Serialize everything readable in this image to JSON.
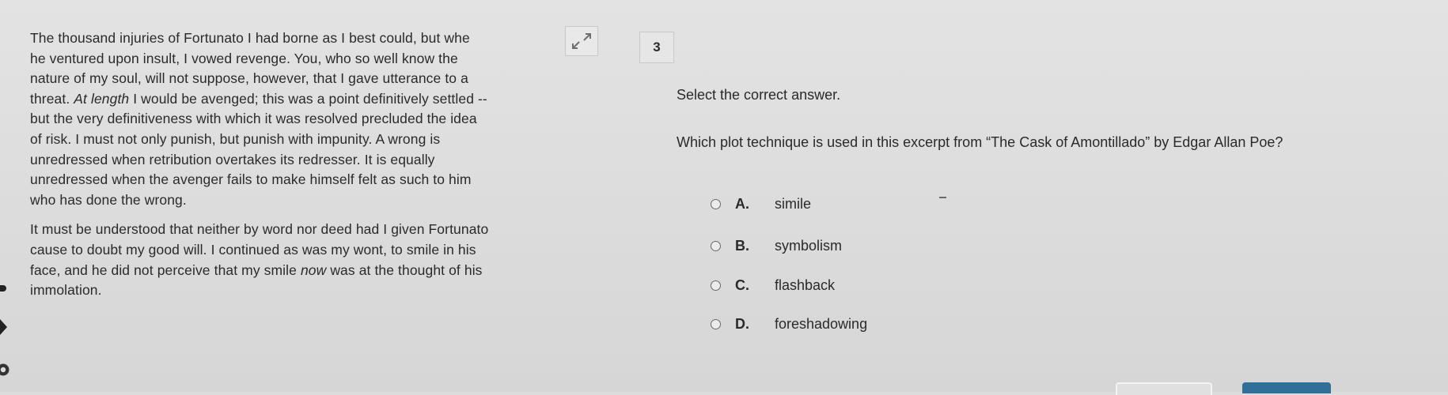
{
  "passage": {
    "paragraph1_before_italic": "The thousand injuries of Fortunato I had borne as I best could, but whe\nhe ventured upon insult, I vowed revenge. You, who so well know the\nnature of my soul, will not suppose, however, that I gave utterance to a\nthreat. ",
    "paragraph1_italic": "At length",
    "paragraph1_after_italic": " I would be avenged; this was a point definitively settled --\nbut the very definitiveness with which it was resolved precluded the idea\nof risk. I must not only punish, but punish with impunity. A wrong is\nunredressed when retribution overtakes its redresser. It is equally\nunredressed when the avenger fails to make himself felt as such to him\nwho has done the wrong.",
    "paragraph2_before_italic": "It must be understood that neither by word nor deed had I given Fortunato\ncause to doubt my good will. I continued as was my wont, to smile in his\nface, and he did not perceive that my smile ",
    "paragraph2_italic": "now",
    "paragraph2_after_italic": " was at the thought of his\nimmolation."
  },
  "question": {
    "number": "3",
    "prompt": "Select the correct answer.",
    "text": "Which plot technique is used in this excerpt from “The Cask of Amontillado” by Edgar Allan Poe?",
    "options": [
      {
        "letter": "A.",
        "text": "simile"
      },
      {
        "letter": "B.",
        "text": "symbolism"
      },
      {
        "letter": "C.",
        "text": "flashback"
      },
      {
        "letter": "D.",
        "text": "foreshadowing"
      }
    ]
  },
  "icons": {
    "expand": "expand-arrows-icon",
    "gear": "gear-icon",
    "back": "back-arrow-icon"
  },
  "colors": {
    "background": "#dcdcdc",
    "text": "#2a2a2a",
    "accent_button": "#2f6f98"
  }
}
